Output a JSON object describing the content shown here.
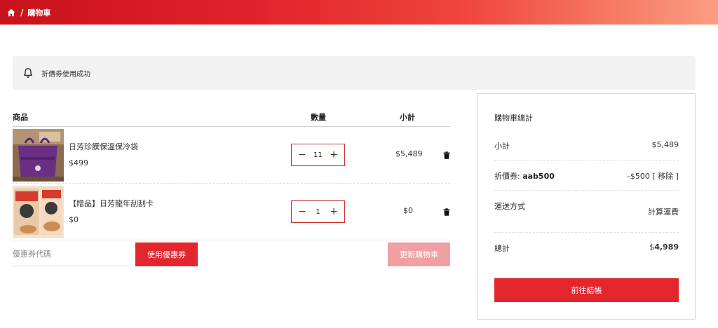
{
  "breadcrumb": {
    "current": "購物車",
    "separator": "/"
  },
  "notice": {
    "message": "折價券使用成功"
  },
  "cart": {
    "headers": {
      "product": "商品",
      "quantity": "數量",
      "subtotal": "小計"
    },
    "items": [
      {
        "name": "日芳珍饌保溫保冷袋",
        "price": "$499",
        "quantity": "11",
        "subtotal": "$5,489"
      },
      {
        "name": "【贈品】日芳龍年刮刮卡",
        "price": "$0",
        "quantity": "1",
        "subtotal": "$0"
      }
    ],
    "coupon_placeholder": "優惠券代碼",
    "apply_label": "使用優惠券",
    "update_label": "更新購物車"
  },
  "totals": {
    "title": "購物車總計",
    "subtotal_label": "小計",
    "subtotal_value": "$5,489",
    "coupon_label_prefix": "折價券: ",
    "coupon_code": "aab500",
    "coupon_discount": "–$500",
    "remove_label": "[ 移除 ]",
    "shipping_label": "運送方式",
    "shipping_value": "計算運費",
    "total_label": "總計",
    "total_currency": "$",
    "total_amount": "4,989",
    "checkout_label": "前往結帳"
  },
  "colors": {
    "accent": "#e3262d",
    "accent_light": "#f0a0a2",
    "notice_bg": "#f2f2f2"
  },
  "icons": [
    "home-icon",
    "bell-icon",
    "trash-icon"
  ]
}
